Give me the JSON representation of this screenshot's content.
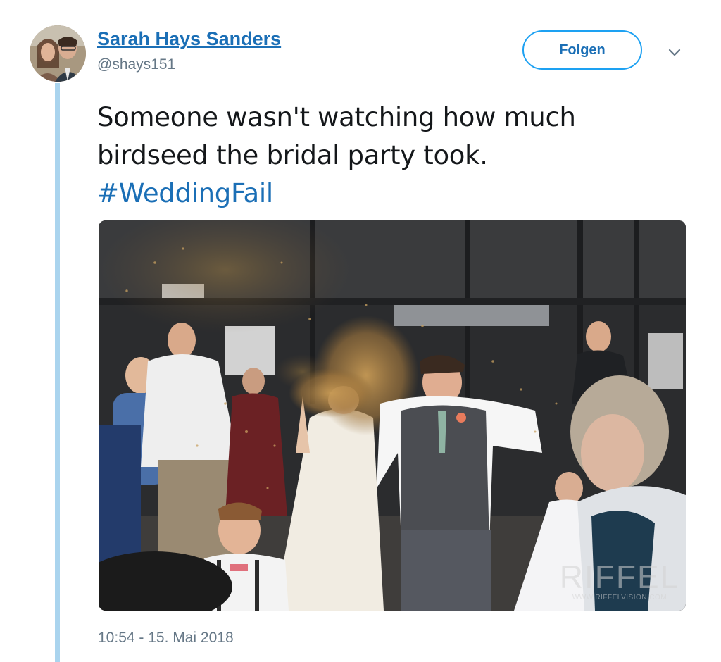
{
  "author": {
    "name": "Sarah Hays Sanders",
    "handle": "@shays151"
  },
  "follow_button": {
    "label": "Folgen"
  },
  "menu": {
    "icon": "chevron-down-icon"
  },
  "tweet": {
    "text": "Someone wasn't watching how much birdseed the bridal party took.",
    "hashtag": "#WeddingFail"
  },
  "media": {
    "watermark": "RIFFEL",
    "watermark_url": "WWW.RIFFELVISION.COM"
  },
  "timestamp": "10:54 - 15. Mai 2018",
  "colors": {
    "link": "#1b6fb6",
    "follow_border": "#1da1f2",
    "thread_line": "#aad4ee",
    "secondary_text": "#657786"
  }
}
